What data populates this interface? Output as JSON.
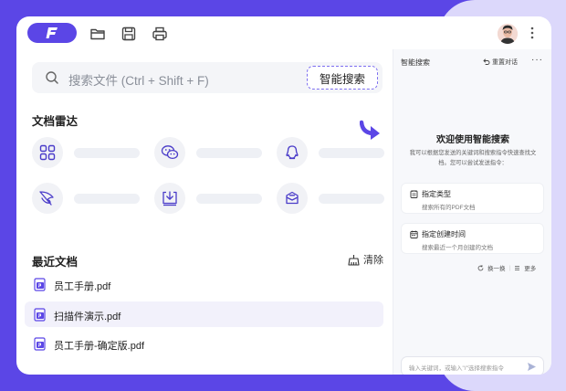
{
  "topbar": {
    "logo_icon": "f-logo-icon",
    "icons": [
      "folder-icon",
      "save-icon",
      "print-icon"
    ],
    "avatar_icon": "user-avatar",
    "more_icon": "kebab-icon"
  },
  "search": {
    "placeholder": "搜索文件 (Ctrl + Shift + F)",
    "smart_button": "智能搜索"
  },
  "radar": {
    "title": "文档雷达",
    "items": [
      {
        "icon": "apps-grid-icon"
      },
      {
        "icon": "wechat-icon"
      },
      {
        "icon": "qq-icon"
      },
      {
        "icon": "feather-icon"
      },
      {
        "icon": "download-icon"
      },
      {
        "icon": "mail-icon"
      }
    ]
  },
  "recent": {
    "title": "最近文档",
    "clear_label": "清除",
    "docs": [
      {
        "name": "员工手册.pdf"
      },
      {
        "name": "扫描件演示.pdf"
      },
      {
        "name": "员工手册-确定版.pdf"
      }
    ]
  },
  "panel": {
    "title": "智能搜索",
    "reset_label": "重置对话",
    "more": "···",
    "welcome": "欢迎使用智能搜索",
    "welcome_sub": "我可以根据您发送的关键词和搜索指令快速查找文档。您可以尝试发送指令：",
    "cards": [
      {
        "title": "指定类型",
        "sub": "搜索所有的PDF文档",
        "icon": "file-type-icon"
      },
      {
        "title": "指定创建时间",
        "sub": "搜索最近一个月创建的文档",
        "icon": "calendar-icon"
      }
    ],
    "refresh_label": "换一换",
    "more_label": "更多",
    "input_placeholder": "输入关键词，或输入\"/\"选择搜索指令"
  },
  "colors": {
    "brand": "#5b46e6",
    "brand_light": "#dcd8fb",
    "accent_border": "#7d6ff0"
  }
}
